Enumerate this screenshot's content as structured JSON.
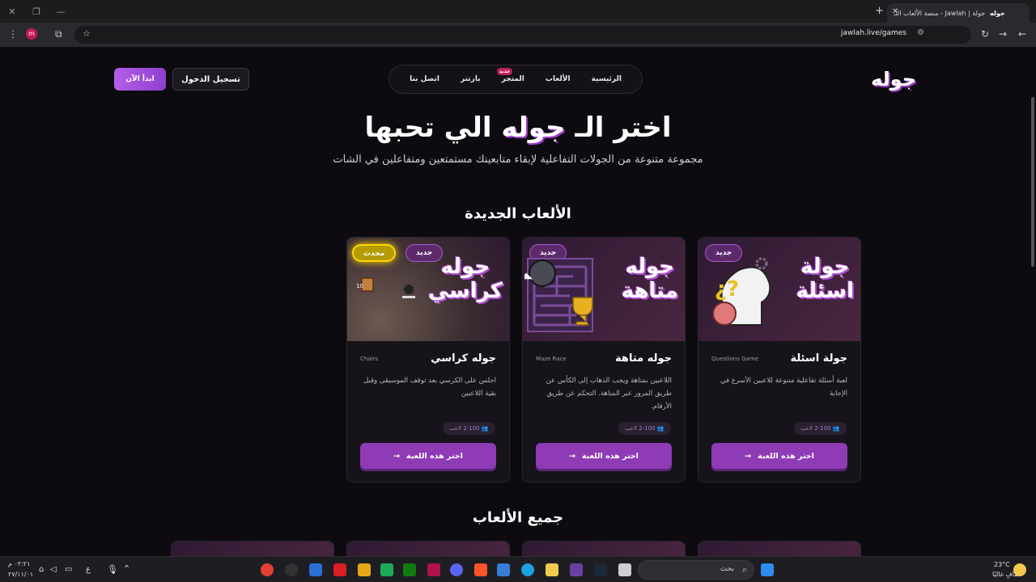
{
  "browser": {
    "tab_title": "جولة | Jawlah - منصة الألعاب التـ",
    "tab_favicon": "جوله",
    "url": "jawlah.live/games",
    "avatar": "m"
  },
  "nav": {
    "logo": "جوله",
    "items": [
      "الرئيسية",
      "الألعاب",
      "المتجر",
      "بارتنر",
      "اتصل بنا"
    ],
    "store_badge": "جديد",
    "login": "تسجيل الدخول",
    "start": "ابدأ الآن"
  },
  "hero": {
    "title_pre": "اختر الـ",
    "title_hl": "جوله",
    "title_post": "الي تحبها",
    "subtitle": "مجموعة متنوعة من الجولات التفاعلية لإبقاء متابعينك مستمتعين ومتفاعلين في الشات"
  },
  "sections": {
    "new_games": "الألعاب الجديدة",
    "all_games": "جميع الألعاب"
  },
  "cards": [
    {
      "thumb_title": "جولة\nاسئلة",
      "badge": "جديد",
      "name": "جولة اسئلة",
      "en": "Questions Game",
      "desc": "لعبة أسئلة تفاعلية متنوعة للاعبين الأسرع في الإجابة",
      "players": "2-100 لاعب",
      "cta": "اختر هذه اللعبة"
    },
    {
      "thumb_title": "جوله\nمتاهة",
      "badge": "جديد",
      "name": "جوله متاهة",
      "en": "Maze Race",
      "desc": "اللاعبين بمتاهة ويجب الذهاب إلى الكأس عن طريق المرور عبر المتاهة. التحكم عن طريق الأرقام.",
      "players": "2-100 لاعب",
      "cta": "اختر هذه اللعبة"
    },
    {
      "thumb_title": "جوله\nكراسي",
      "badge": "جديد",
      "badge2": "محدث",
      "name": "جوله كراسي",
      "en": "Chairs",
      "desc": "اجلس على الكرسي بعد توقف الموسيقى وقبل بقية اللاعبين",
      "players": "2-100 لاعب",
      "cta": "اختر هذه اللعبة"
    }
  ],
  "taskbar": {
    "search": "بحث",
    "weather_temp": "23°C",
    "weather_desc": "صافٍ غالبًا",
    "lang": "ع",
    "date": "٢٧/١١/٠١",
    "time": "٠٢:٢١ م"
  },
  "colors": {
    "accent": "#8e3bb5",
    "bg": "#0e0b10"
  }
}
